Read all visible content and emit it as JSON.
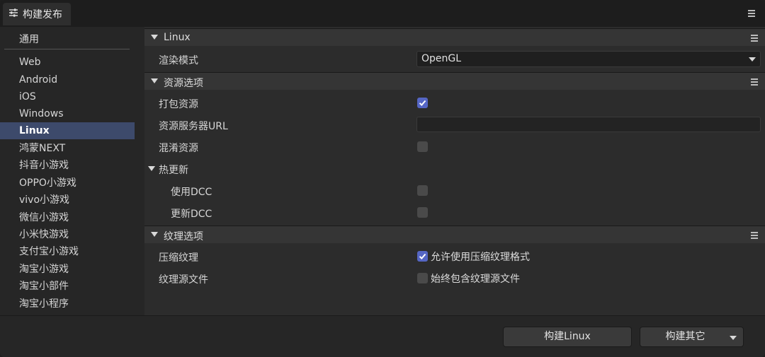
{
  "window": {
    "tab_title": "构建发布"
  },
  "sidebar": {
    "header": "通用",
    "items": [
      {
        "label": "Web"
      },
      {
        "label": "Android"
      },
      {
        "label": "iOS"
      },
      {
        "label": "Windows"
      },
      {
        "label": "Linux",
        "active": true
      },
      {
        "label": "鸿蒙NEXT"
      },
      {
        "label": "抖音小游戏"
      },
      {
        "label": "OPPO小游戏"
      },
      {
        "label": "vivo小游戏"
      },
      {
        "label": "微信小游戏"
      },
      {
        "label": "小米快游戏"
      },
      {
        "label": "支付宝小游戏"
      },
      {
        "label": "淘宝小游戏"
      },
      {
        "label": "淘宝小部件"
      },
      {
        "label": "淘宝小程序"
      }
    ]
  },
  "sections": {
    "linux": {
      "title": "Linux",
      "render_mode_label": "渲染模式",
      "render_mode_value": "OpenGL"
    },
    "resources": {
      "title": "资源选项",
      "pack_label": "打包资源",
      "pack_checked": true,
      "server_url_label": "资源服务器URL",
      "server_url_value": "",
      "obfuscate_label": "混淆资源",
      "obfuscate_checked": false,
      "hot_update": {
        "label": "热更新",
        "use_dcc_label": "使用DCC",
        "use_dcc_checked": false,
        "update_dcc_label": "更新DCC",
        "update_dcc_checked": false
      }
    },
    "texture": {
      "title": "纹理选项",
      "compress_label": "压缩纹理",
      "compress_option": "允许使用压缩纹理格式",
      "compress_checked": true,
      "source_label": "纹理源文件",
      "source_option": "始终包含纹理源文件",
      "source_checked": false
    }
  },
  "footer": {
    "build_label": "构建Linux",
    "build_other_label": "构建其它"
  },
  "colors": {
    "accent": "#5566c4",
    "selected_item": "#3d4a6b"
  }
}
